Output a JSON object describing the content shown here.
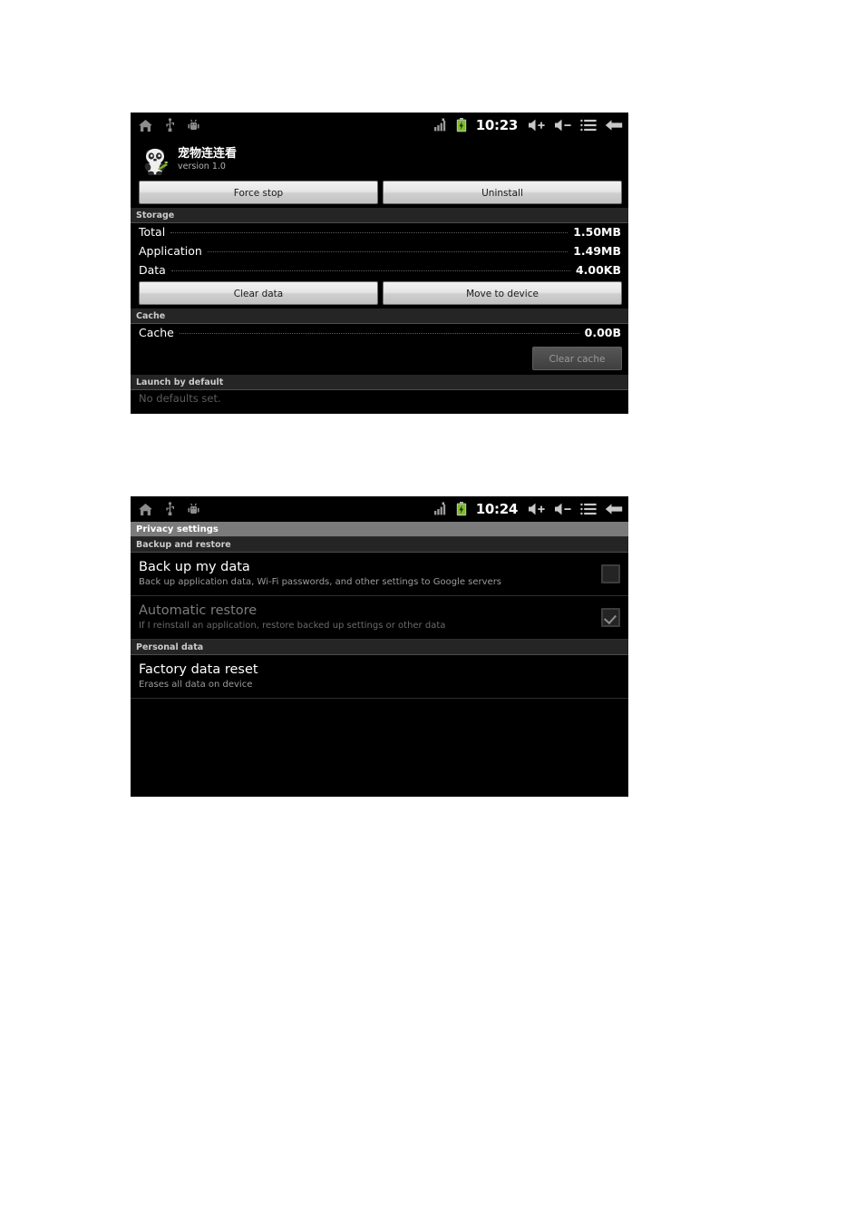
{
  "screen1": {
    "statusbar": {
      "left_icons": [
        "home-icon",
        "usb-icon",
        "android-debug-icon"
      ],
      "signal_icon": "signal-bars-no-service-icon",
      "battery_icon": "battery-charging-icon",
      "time": "10:23",
      "volume_up_icon": "volume-up-icon",
      "volume_down_icon": "volume-down-icon",
      "menu_icon": "menu-icon",
      "back_icon": "back-arrow-icon",
      "battery_color": "#7cbe28"
    },
    "app": {
      "icon": "panda-app-icon",
      "name": "宠物连连看",
      "version": "version 1.0"
    },
    "actions": {
      "force_stop": "Force stop",
      "uninstall": "Uninstall"
    },
    "storage": {
      "header": "Storage",
      "rows": [
        {
          "label": "Total",
          "value": "1.50MB"
        },
        {
          "label": "Application",
          "value": "1.49MB"
        },
        {
          "label": "Data",
          "value": "4.00KB"
        }
      ],
      "clear_data": "Clear data",
      "move_to_device": "Move to device"
    },
    "cache": {
      "header": "Cache",
      "row": {
        "label": "Cache",
        "value": "0.00B"
      },
      "clear_cache": "Clear cache",
      "clear_cache_disabled": true
    },
    "launch_by_default": {
      "header": "Launch by default",
      "text": "No defaults set."
    }
  },
  "screen2": {
    "statusbar": {
      "left_icons": [
        "home-icon",
        "usb-icon",
        "android-debug-icon"
      ],
      "signal_icon": "signal-bars-no-service-icon",
      "battery_icon": "battery-charging-icon",
      "time": "10:24",
      "volume_up_icon": "volume-up-icon",
      "volume_down_icon": "volume-down-icon",
      "menu_icon": "menu-icon",
      "back_icon": "back-arrow-icon",
      "battery_color": "#7cbe28"
    },
    "title": "Privacy settings",
    "backup_section": {
      "header": "Backup and restore",
      "items": [
        {
          "title": "Back up my data",
          "subtitle": "Back up application data, Wi-Fi passwords, and other settings to Google servers",
          "checked": false,
          "dimmed": false
        },
        {
          "title": "Automatic restore",
          "subtitle": "If I reinstall an application, restore backed up settings or other data",
          "checked": true,
          "dimmed": true
        }
      ]
    },
    "personal_section": {
      "header": "Personal data",
      "items": [
        {
          "title": "Factory data reset",
          "subtitle": "Erases all data on device"
        }
      ]
    }
  }
}
